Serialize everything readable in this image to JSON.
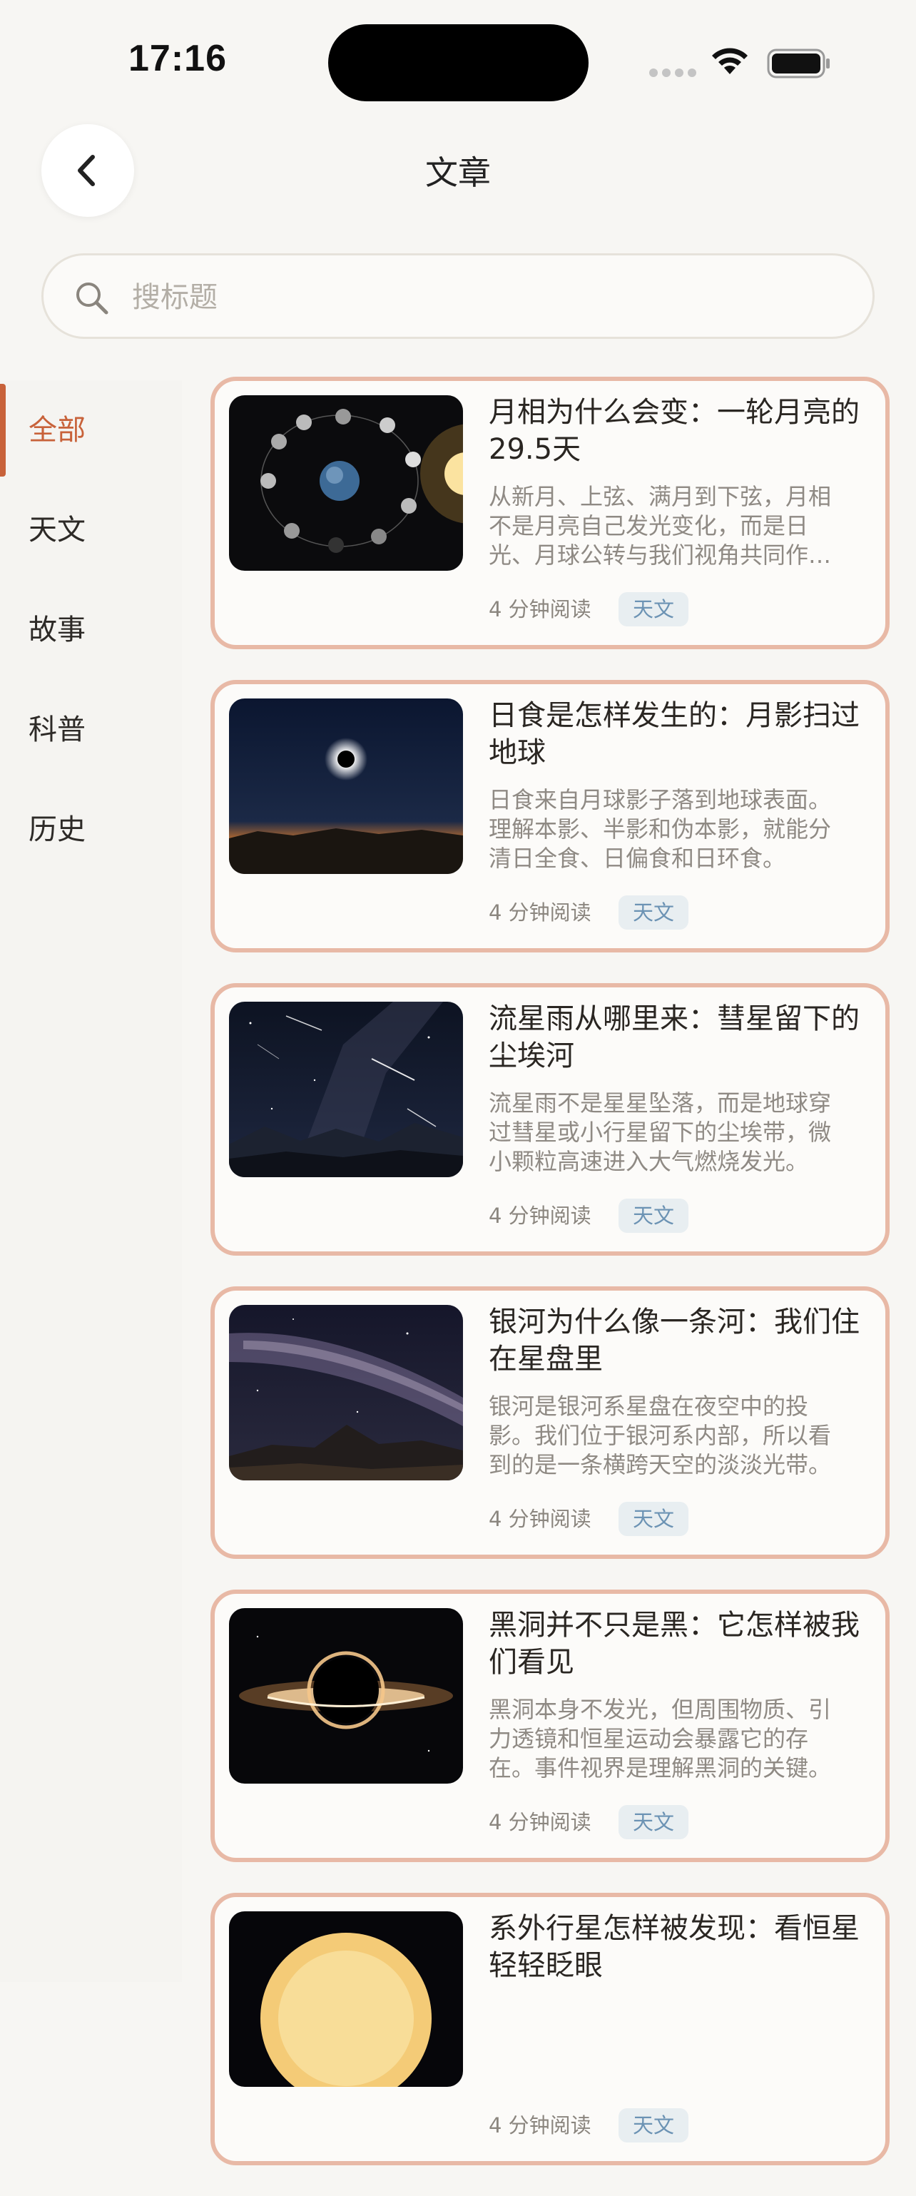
{
  "status_bar": {
    "time": "17:16"
  },
  "header": {
    "title": "文章"
  },
  "search": {
    "placeholder": "搜标题"
  },
  "sidebar": {
    "items": [
      {
        "label": "全部",
        "active": true
      },
      {
        "label": "天文",
        "active": false
      },
      {
        "label": "故事",
        "active": false
      },
      {
        "label": "科普",
        "active": false
      },
      {
        "label": "历史",
        "active": false
      }
    ]
  },
  "colors": {
    "accent": "#c8623a",
    "card_border": "#e8b9a6",
    "tag_bg": "#e8eef1",
    "tag_text": "#6c93b4"
  },
  "articles": [
    {
      "title": "月相为什么会变：一轮月亮的29.5天",
      "summary": "从新月、上弦、满月到下弦，月相不是月亮自己发光变化，而是日光、月球公转与我们视角共同作用的结果。",
      "read_time": "4 分钟阅读",
      "tag": "天文",
      "image": "moon-phases-image"
    },
    {
      "title": "日食是怎样发生的：月影扫过地球",
      "summary": "日食来自月球影子落到地球表面。理解本影、半影和伪本影，就能分清日全食、日偏食和日环食。",
      "read_time": "4 分钟阅读",
      "tag": "天文",
      "image": "solar-eclipse-image"
    },
    {
      "title": "流星雨从哪里来：彗星留下的尘埃河",
      "summary": "流星雨不是星星坠落，而是地球穿过彗星或小行星留下的尘埃带，微小颗粒高速进入大气燃烧发光。",
      "read_time": "4 分钟阅读",
      "tag": "天文",
      "image": "meteor-shower-image"
    },
    {
      "title": "银河为什么像一条河：我们住在星盘里",
      "summary": "银河是银河系星盘在夜空中的投影。我们位于银河系内部，所以看到的是一条横跨天空的淡淡光带。",
      "read_time": "4 分钟阅读",
      "tag": "天文",
      "image": "milky-way-image"
    },
    {
      "title": "黑洞并不只是黑：它怎样被我们看见",
      "summary": "黑洞本身不发光，但周围物质、引力透镜和恒星运动会暴露它的存在。事件视界是理解黑洞的关键。",
      "read_time": "4 分钟阅读",
      "tag": "天文",
      "image": "black-hole-image"
    },
    {
      "title": "系外行星怎样被发现：看恒星轻轻眨眼",
      "summary": "",
      "read_time": "4 分钟阅读",
      "tag": "天文",
      "image": "exoplanet-star-image"
    }
  ]
}
